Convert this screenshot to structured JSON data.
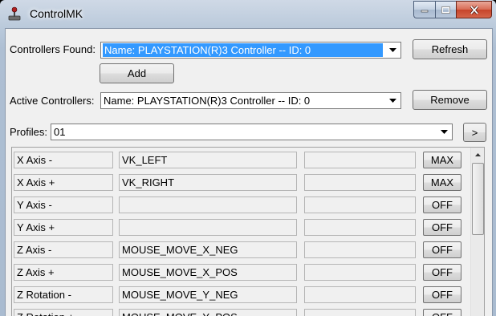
{
  "window": {
    "title": "ControlMK"
  },
  "controllers_found": {
    "label": "Controllers Found:",
    "value": "Name: PLAYSTATION(R)3 Controller -- ID: 0",
    "refresh_label": "Refresh",
    "add_label": "Add"
  },
  "active_controllers": {
    "label": "Active Controllers:",
    "value": "Name: PLAYSTATION(R)3 Controller -- ID: 0",
    "remove_label": "Remove"
  },
  "profiles": {
    "label": "Profiles:",
    "value": "01",
    "next_label": ">"
  },
  "mappings": [
    {
      "axis": "X Axis -",
      "key": "VK_LEFT",
      "extra": "",
      "mode": "MAX"
    },
    {
      "axis": "X Axis +",
      "key": "VK_RIGHT",
      "extra": "",
      "mode": "MAX"
    },
    {
      "axis": "Y Axis -",
      "key": "",
      "extra": "",
      "mode": "OFF"
    },
    {
      "axis": "Y Axis +",
      "key": "",
      "extra": "",
      "mode": "OFF"
    },
    {
      "axis": "Z Axis -",
      "key": "MOUSE_MOVE_X_NEG",
      "extra": "",
      "mode": "OFF"
    },
    {
      "axis": "Z Axis +",
      "key": "MOUSE_MOVE_X_POS",
      "extra": "",
      "mode": "OFF"
    },
    {
      "axis": "Z Rotation -",
      "key": "MOUSE_MOVE_Y_NEG",
      "extra": "",
      "mode": "OFF"
    },
    {
      "axis": "Z Rotation +",
      "key": "MOUSE_MOVE_Y_POS",
      "extra": "",
      "mode": "OFF"
    }
  ]
}
